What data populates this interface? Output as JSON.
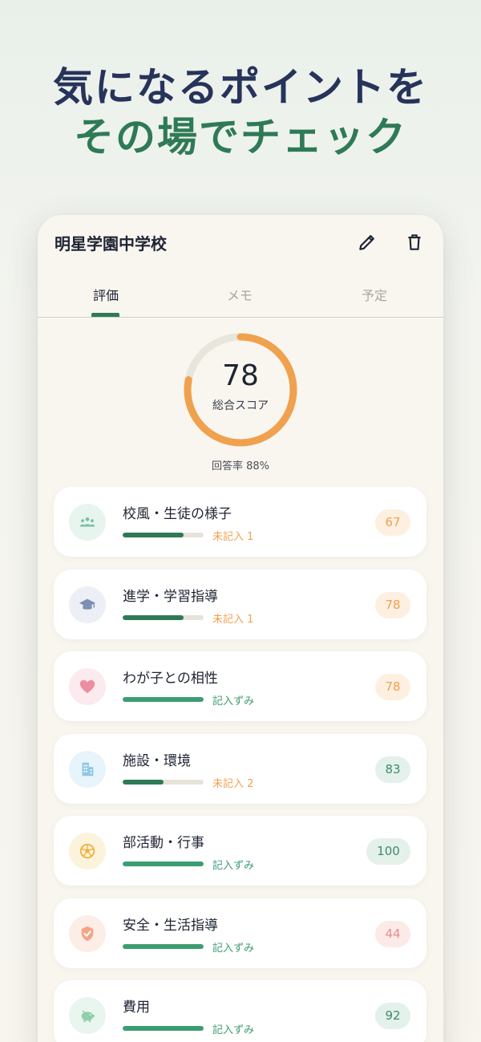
{
  "headline": {
    "line1": "気になるポイントを",
    "line2": "その場でチェック"
  },
  "app": {
    "title": "明星学園中学校"
  },
  "tabs": [
    "評価",
    "メモ",
    "予定"
  ],
  "score": {
    "value": "78",
    "fraction": 0.78,
    "label": "総合スコア",
    "response_rate": "回答率 88%"
  },
  "categories": [
    {
      "name": "校風・生徒の様子",
      "status": "未記入 1",
      "progress": 0.75,
      "score": "67",
      "icon": "people-icon",
      "tone": "orange"
    },
    {
      "name": "進学・学習指導",
      "status": "未記入 1",
      "progress": 0.75,
      "score": "78",
      "icon": "graduation-cap-icon",
      "tone": "orange"
    },
    {
      "name": "わが子との相性",
      "status": "記入ずみ",
      "progress": 1.0,
      "score": "78",
      "icon": "heart-icon",
      "tone": "orange"
    },
    {
      "name": "施設・環境",
      "status": "未記入 2",
      "progress": 0.5,
      "score": "83",
      "icon": "building-icon",
      "tone": "green"
    },
    {
      "name": "部活動・行事",
      "status": "記入ずみ",
      "progress": 1.0,
      "score": "100",
      "icon": "soccer-ball-icon",
      "tone": "green"
    },
    {
      "name": "安全・生活指導",
      "status": "記入ずみ",
      "progress": 1.0,
      "score": "44",
      "icon": "shield-check-icon",
      "tone": "red"
    },
    {
      "name": "費用",
      "status": "記入ずみ",
      "progress": 1.0,
      "score": "92",
      "icon": "piggy-bank-icon",
      "tone": "green"
    }
  ],
  "colors": {
    "headline_navy": "#27335a",
    "headline_green": "#2f7a56",
    "accent_orange": "#f0a14e",
    "accent_green": "#3c9d72",
    "dark_green": "#2f7a56"
  }
}
